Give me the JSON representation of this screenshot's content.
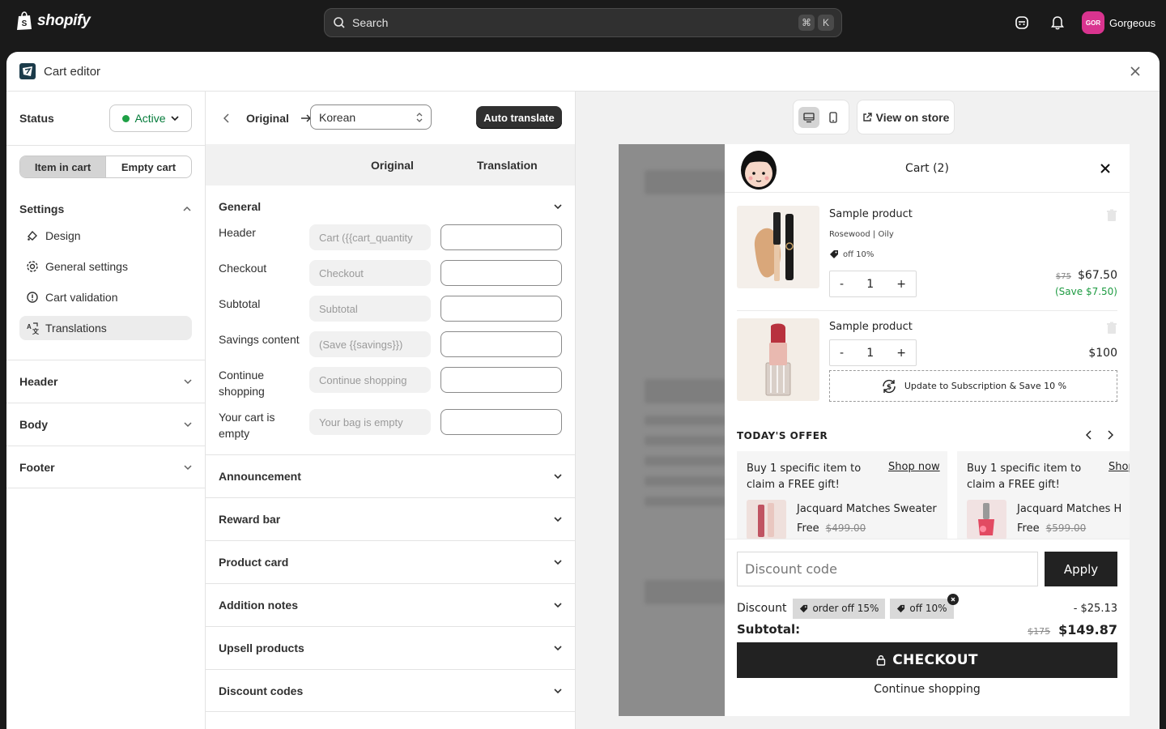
{
  "topbar": {
    "logo_text": "shopify",
    "search_placeholder": "Search",
    "kbd_1": "⌘",
    "kbd_2": "K",
    "avatar_initials": "GOR",
    "store_name": "Gorgeous"
  },
  "modal": {
    "title": "Cart editor"
  },
  "left": {
    "status_label": "Status",
    "status_value": "Active",
    "seg_item": "Item in cart",
    "seg_empty": "Empty cart",
    "settings_label": "Settings",
    "nav": [
      "Design",
      "General settings",
      "Cart validation",
      "Translations"
    ],
    "sections": [
      "Header",
      "Body",
      "Footer"
    ]
  },
  "mid": {
    "original": "Original",
    "language": "Korean",
    "auto_translate": "Auto translate",
    "col_original": "Original",
    "col_translation": "Translation",
    "general": "General",
    "fields": [
      {
        "label": "Header",
        "placeholder": "Cart ({{cart_quantity"
      },
      {
        "label": "Checkout",
        "placeholder": "Checkout"
      },
      {
        "label": "Subtotal",
        "placeholder": "Subtotal"
      },
      {
        "label": "Savings content",
        "placeholder": "(Save {{savings}})"
      },
      {
        "label": "Continue shopping",
        "placeholder": "Continue shopping"
      },
      {
        "label": "Your cart is empty",
        "placeholder": "Your bag is empty"
      }
    ],
    "sections": [
      "Announcement",
      "Reward bar",
      "Product card",
      "Addition notes",
      "Upsell products",
      "Discount codes"
    ]
  },
  "preview": {
    "view_on_store": "View on store",
    "cart_title": "Cart (2)",
    "items": [
      {
        "name": "Sample product",
        "variant": "Rosewood | Oily",
        "discount": "off 10%",
        "qty": "1",
        "old_price": "$75",
        "price": "$67.50",
        "save": "(Save $7.50)"
      },
      {
        "name": "Sample product",
        "qty": "1",
        "price": "$100",
        "subscription": "Update to Subscription & Save 10 %"
      }
    ],
    "offer_heading": "TODAY'S OFFER",
    "offers": [
      {
        "text": "Buy 1 specific item to claim a FREE gift!",
        "shop": "Shop now",
        "product": "Jacquard Matches Sweater",
        "free": "Free",
        "old": "$499.00"
      },
      {
        "text": "Buy 1 specific item to claim a FREE gift!",
        "shop": "Shop now",
        "product": "Jacquard Matches H",
        "free": "Free",
        "old": "$599.00"
      }
    ],
    "discount_placeholder": "Discount code",
    "apply": "Apply",
    "discount_label": "Discount",
    "tags": [
      "order off 15%",
      "off 10%"
    ],
    "discount_amount": "- $25.13",
    "subtotal_label": "Subtotal:",
    "subtotal_old": "$175",
    "subtotal": "$149.87",
    "checkout": "CHECKOUT",
    "continue": "Continue shopping"
  },
  "colors": {
    "accent_green": "#1ea045",
    "dark": "#303030",
    "save_green": "#1e9b42",
    "avatar": "#d9348f"
  }
}
